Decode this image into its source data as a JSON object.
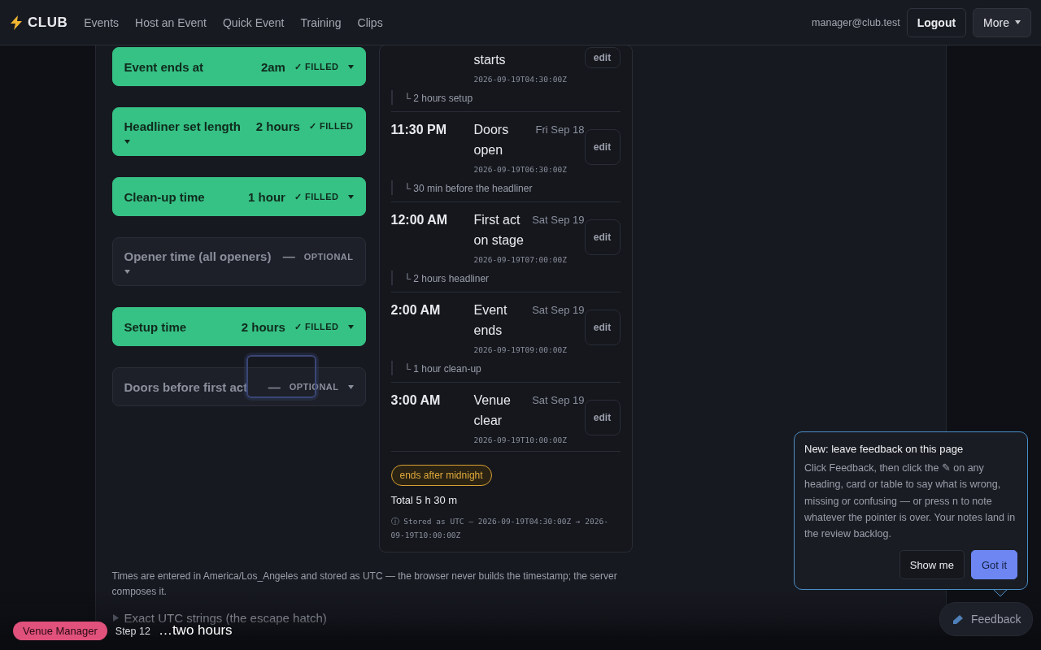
{
  "nav": {
    "brand": "CLUB",
    "links": [
      "Events",
      "Host an Event",
      "Quick Event",
      "Training",
      "Clips"
    ],
    "user": "manager@club.test",
    "logout": "Logout",
    "more": "More"
  },
  "fields": [
    {
      "label": "Event ends at",
      "value": "2am",
      "kind": "filled",
      "badge": "✓ FILLED"
    },
    {
      "label": "Headliner set length",
      "value": "2 hours",
      "kind": "filled",
      "badge": "✓ FILLED"
    },
    {
      "label": "Clean-up time",
      "value": "1 hour",
      "kind": "filled",
      "badge": "✓ FILLED"
    },
    {
      "label": "Opener time (all openers)",
      "value": "—",
      "kind": "optional",
      "badge": "OPTIONAL"
    },
    {
      "label": "Setup time",
      "value": "2 hours",
      "kind": "filled",
      "badge": "✓ FILLED"
    },
    {
      "label": "Doors before first act",
      "value": "—",
      "kind": "optional",
      "badge": "OPTIONAL"
    }
  ],
  "timeline": {
    "entries": [
      {
        "label": "starts",
        "stamp": "2026-09-19T04:30:00Z",
        "edit": "edit",
        "gap": "└ 2 hours setup"
      },
      {
        "time": "11:30 PM",
        "label": "Doors open",
        "date": "Fri Sep 18",
        "stamp": "2026-09-19T06:30:00Z",
        "edit": "edit",
        "gap": "└ 30 min before the headliner"
      },
      {
        "time": "12:00 AM",
        "label": "First act on stage",
        "date": "Sat Sep 19",
        "stamp": "2026-09-19T07:00:00Z",
        "edit": "edit",
        "gap": "└ 2 hours headliner"
      },
      {
        "time": "2:00 AM",
        "label": "Event ends",
        "date": "Sat Sep 19",
        "stamp": "2026-09-19T09:00:00Z",
        "edit": "edit",
        "gap": "└ 1 hour clean-up"
      },
      {
        "time": "3:00 AM",
        "label": "Venue clear",
        "date": "Sat Sep 19",
        "stamp": "2026-09-19T10:00:00Z",
        "edit": "edit"
      }
    ],
    "badge": "ends after midnight",
    "total": "Total 5 h 30 m",
    "stored": "ⓘ Stored as UTC – 2026-09-19T04:30:00Z → 2026-09-19T10:00:00Z"
  },
  "note": "Times are entered in America/Los_Angeles and stored as UTC — the browser never builds the timestamp; the server composes it.",
  "details": {
    "summary": "Exact UTC strings (the escape hatch)",
    "expanded": false
  },
  "tour": {
    "role": "Venue Manager",
    "step": "Step 12",
    "caption": "…two hours"
  },
  "popover": {
    "title": "New: leave feedback on this page",
    "body": "Click Feedback, then click the ✎ on any heading, card or table to say what is wrong, missing or confusing — or press n to note whatever the pointer is over. Your notes land in the review backlog.",
    "buttons": [
      {
        "label": "Show me",
        "primary": false
      },
      {
        "label": "Got it",
        "primary": true
      }
    ]
  },
  "feedback": "Feedback"
}
